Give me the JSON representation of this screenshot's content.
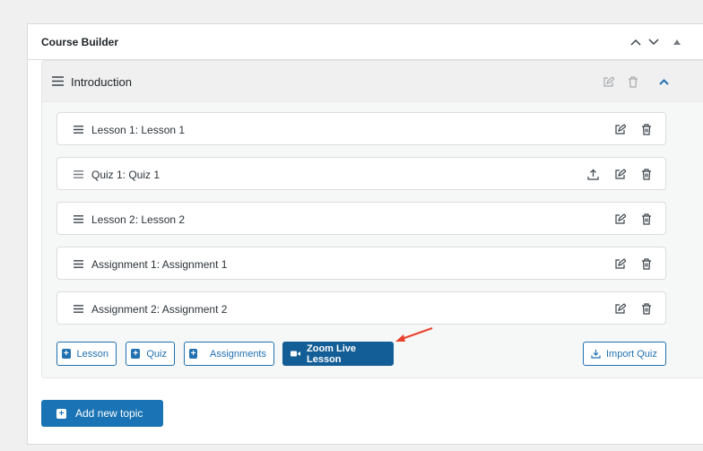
{
  "course_builder": {
    "title": "Course Builder"
  },
  "topic": {
    "title": "Introduction",
    "items": [
      {
        "label": "Lesson 1: Lesson 1",
        "has_upload": false
      },
      {
        "label": "Quiz 1: Quiz 1",
        "has_upload": true
      },
      {
        "label": "Lesson 2: Lesson 2",
        "has_upload": false
      },
      {
        "label": "Assignment 1: Assignment 1",
        "has_upload": false
      },
      {
        "label": "Assignment 2: Assignment 2",
        "has_upload": false
      }
    ],
    "buttons": {
      "lesson": "Lesson",
      "quiz": "Quiz",
      "assignments": "Assignments",
      "zoom": "Zoom Live Lesson",
      "import": "Import Quiz"
    }
  },
  "add_topic": {
    "label": "Add new topic"
  },
  "colors": {
    "accent": "#2271b1",
    "primary_button": "#135e96",
    "annotation_arrow": "#e8422f"
  }
}
